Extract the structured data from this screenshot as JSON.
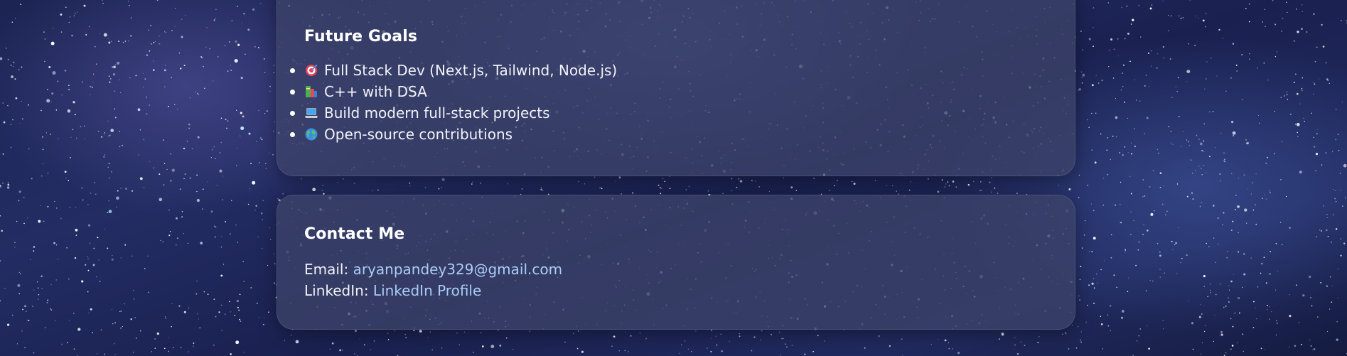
{
  "background": {
    "style": "starfield",
    "base_color": "#1f2858"
  },
  "goals": {
    "title": "Future Goals",
    "items": [
      {
        "icon": "target-icon",
        "text": "Full Stack Dev (Next.js, Tailwind, Node.js)"
      },
      {
        "icon": "books-icon",
        "text": "C++ with DSA"
      },
      {
        "icon": "laptop-icon",
        "text": "Build modern full-stack projects"
      },
      {
        "icon": "globe-icon",
        "text": "Open-source contributions"
      }
    ]
  },
  "contact": {
    "title": "Contact Me",
    "email_label": "Email:",
    "email_value": "aryanpandey329@gmail.com",
    "linkedin_label": "LinkedIn:",
    "linkedin_value": "LinkedIn Profile"
  },
  "colors": {
    "card_bg": "rgba(60,66,105,0.78)",
    "link": "#a9cdf5",
    "text": "#f1f2f8"
  }
}
